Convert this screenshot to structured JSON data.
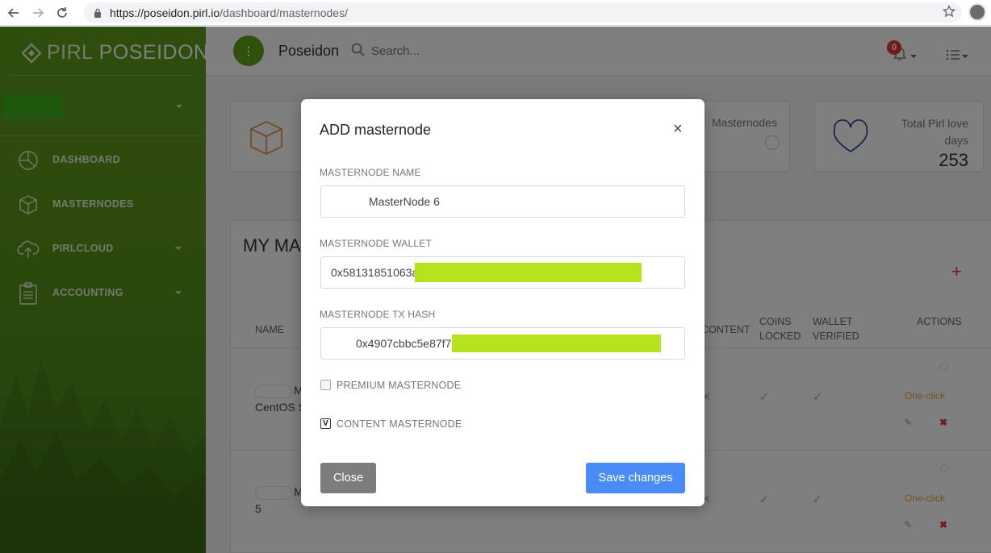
{
  "browser": {
    "url_host": "https://poseidon.pirl.io",
    "url_path": "/dashboard/masternodes/"
  },
  "sidebar": {
    "brand_a": "PIRL",
    "brand_b": "POSEIDON",
    "items": [
      {
        "label": "DASHBOARD",
        "icon": "pie-chart-icon"
      },
      {
        "label": "MASTERNODES",
        "icon": "cube-icon"
      },
      {
        "label": "PIRLCLOUD",
        "icon": "cloud-upload-icon"
      },
      {
        "label": "ACCOUNTING",
        "icon": "clipboard-icon"
      }
    ]
  },
  "topbar": {
    "title": "Poseidon",
    "search_placeholder": "Search...",
    "notifications": "0"
  },
  "cards": {
    "masternodes_label": "Masternodes",
    "love_label": "Total Pirl love days",
    "love_value": "253"
  },
  "panel": {
    "title": "MY MA",
    "headers": {
      "name": "NAME",
      "content": "CONTENT",
      "coins_a": "COINS",
      "coins_b": "LOCKED",
      "wallet_a": "WALLET",
      "wallet_b": "VERIFIED",
      "actions": "ACTIONS"
    },
    "rows": [
      {
        "name_a": "M",
        "name_b": "CentOS S",
        "action": "One-click"
      },
      {
        "name_a": "M",
        "name_b": "5",
        "action": "One-click"
      }
    ]
  },
  "modal": {
    "title": "ADD masternode",
    "name_label": "MASTERNODE NAME",
    "name_value": "MasterNode 6",
    "wallet_label": "MASTERNODE WALLET",
    "wallet_value": "0x58131851063a",
    "hash_label": "MASTERNODE TX HASH",
    "hash_value": "0x4907cbbc5e87f7",
    "premium_label": "PREMIUM MASTERNODE",
    "premium_checked": false,
    "content_label": "CONTENT MASTERNODE",
    "content_checked": true,
    "close_label": "Close",
    "save_label": "Save changes"
  },
  "colors": {
    "sidebar_green": "#5e9b1b",
    "redaction": "#b6e31e",
    "primary_blue": "#4a8cf7",
    "close_grey": "#7d7d7d",
    "badge_red": "#e53935"
  }
}
